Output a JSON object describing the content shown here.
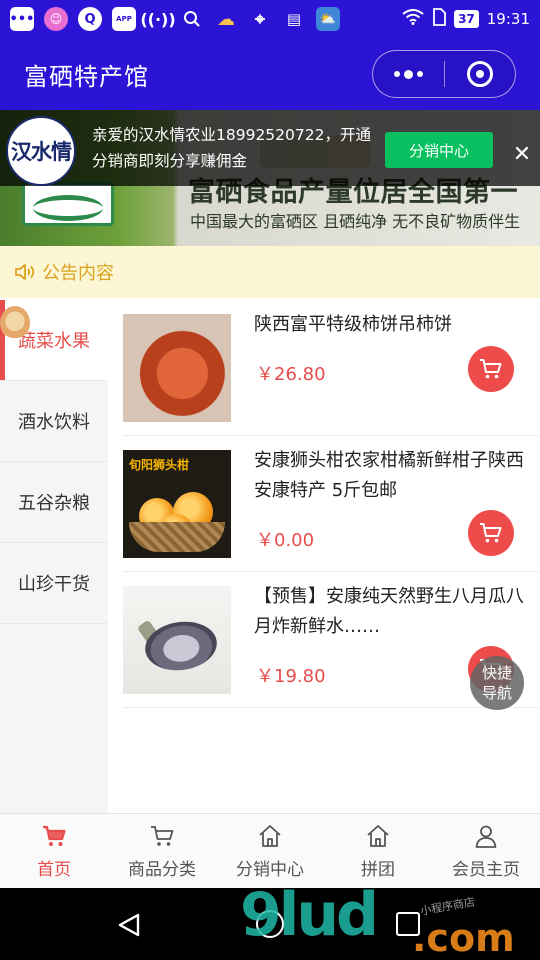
{
  "status_bar": {
    "time": "19:31",
    "battery": "37",
    "left_icons": [
      "message-icon",
      "smile-icon",
      "q-icon",
      "app-store-icon",
      "hotspot-icon",
      "search-icon",
      "weather-icon",
      "location-icon",
      "film-icon",
      "weather-app-icon"
    ],
    "app_badge": "APP"
  },
  "navbar": {
    "title": "富硒特产馆",
    "bg_color": "#2b14d6"
  },
  "banner": {
    "headline": "富硒食品产量位居全国第一",
    "sub": "中国最大的富硒区 且硒纯净 无不良矿物质伴生"
  },
  "notice": {
    "logo_text": "汉水情",
    "text": "亲爱的汉水情农业18992520722，开通分销商即刻分享赚佣金",
    "button": "分销中心",
    "close": "✕"
  },
  "announcement": {
    "label": "公告内容"
  },
  "categories": [
    {
      "label": "蔬菜水果",
      "active": true
    },
    {
      "label": "酒水饮料",
      "active": false
    },
    {
      "label": "五谷杂粮",
      "active": false
    },
    {
      "label": "山珍干货",
      "active": false
    }
  ],
  "products": [
    {
      "title": "陕西富平特级柿饼吊柿饼",
      "price": "￥26.80"
    },
    {
      "title": "安康狮头柑农家柑橘新鲜柑子陕西安康特产 5斤包邮",
      "price": "￥0.00",
      "image_label": "旬阳狮头柑"
    },
    {
      "title": "【预售】安康纯天然野生八月瓜八月炸新鲜水……",
      "price": "￥19.80"
    }
  ],
  "quick_nav": "快捷\n导航",
  "quick_nav_lines": [
    "快捷",
    "导航"
  ],
  "tabs": [
    {
      "label": "首页",
      "icon": "cart-icon",
      "active": true
    },
    {
      "label": "商品分类",
      "icon": "cart-icon",
      "active": false
    },
    {
      "label": "分销中心",
      "icon": "home-icon",
      "active": false
    },
    {
      "label": "拼团",
      "icon": "home-icon",
      "active": false
    },
    {
      "label": "会员主页",
      "icon": "user-icon",
      "active": false
    }
  ],
  "watermark": {
    "big": "9lud",
    "com": ".com",
    "small": "小程序商店"
  },
  "colors": {
    "accent": "#e84d4d",
    "green_button": "#07c160",
    "announce_bg": "#fcf6d5",
    "announce_text": "#d9a521"
  }
}
